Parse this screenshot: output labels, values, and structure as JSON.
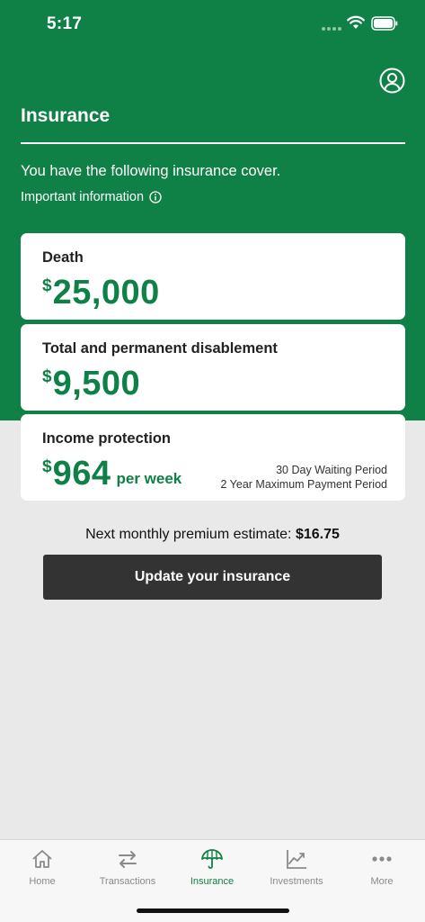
{
  "status_bar": {
    "time": "5:17"
  },
  "header": {
    "title": "Insurance",
    "intro": "You have the following insurance cover.",
    "important_info": "Important information"
  },
  "cards": {
    "death": {
      "title": "Death",
      "currency": "$",
      "amount": "25,000"
    },
    "tpd": {
      "title": "Total and permanent disablement",
      "currency": "$",
      "amount": "9,500"
    },
    "income_protection": {
      "title": "Income protection",
      "currency": "$",
      "amount": "964",
      "unit": "per week",
      "waiting_period": "30 Day Waiting Period",
      "max_payment_period": "2 Year Maximum Payment Period"
    }
  },
  "premium": {
    "label": "Next monthly premium estimate:",
    "value": "$16.75"
  },
  "update_button": {
    "label": "Update your insurance"
  },
  "tab_bar": {
    "items": [
      {
        "label": "Home",
        "icon": "home-icon"
      },
      {
        "label": "Transactions",
        "icon": "transactions-icon"
      },
      {
        "label": "Insurance",
        "icon": "umbrella-icon",
        "active": true
      },
      {
        "label": "Investments",
        "icon": "chart-icon"
      },
      {
        "label": "More",
        "icon": "more-icon"
      }
    ]
  },
  "colors": {
    "brand_green": "#0f8046",
    "button_dark": "#333333",
    "background": "#e9e9e9"
  }
}
